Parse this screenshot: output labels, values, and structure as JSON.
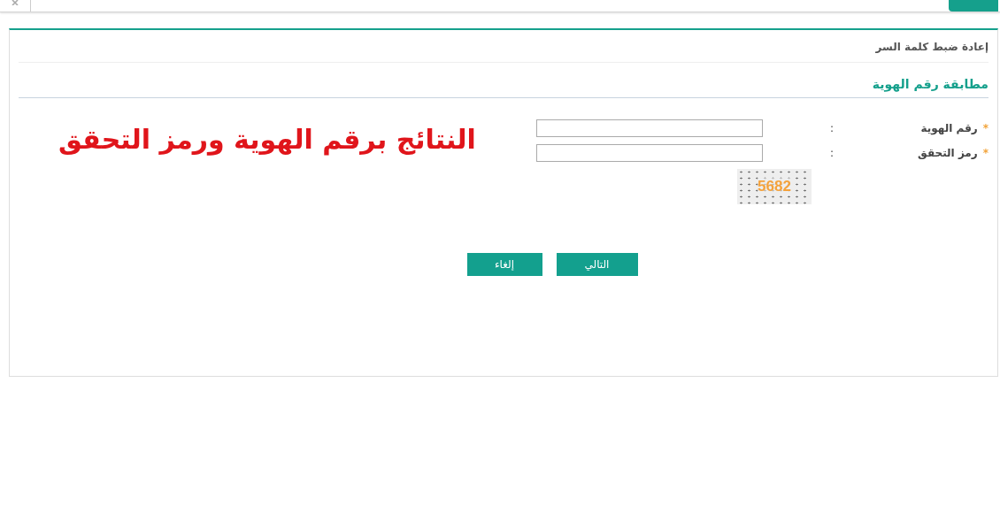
{
  "page_title": "إعادة ضبط كلمة السر",
  "section_title": "مطابقة رقم الهوية",
  "overlay_caption": "النتائج برقم الهوية ورمز التحقق",
  "fields": [
    {
      "required_mark": "*",
      "label": "رقم الهوية",
      "separator": ":"
    },
    {
      "required_mark": "*",
      "label": "رمز التحقق",
      "separator": ":"
    }
  ],
  "captcha": {
    "code": "5682"
  },
  "buttons": [
    {
      "label": "التالي"
    },
    {
      "label": "إلغاء"
    }
  ]
}
